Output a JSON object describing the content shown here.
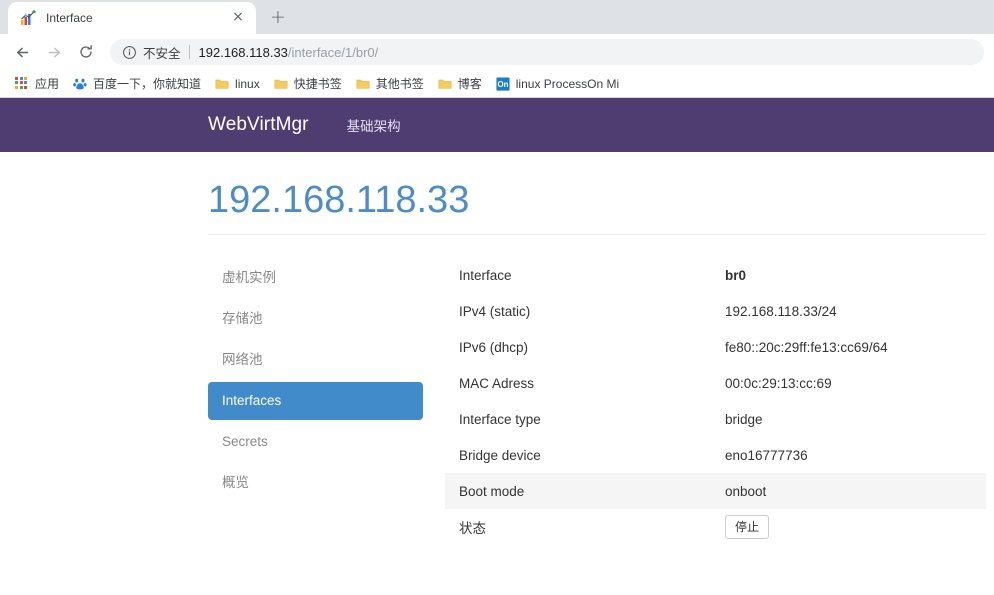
{
  "browser": {
    "tab": {
      "title": "Interface",
      "favicon_name": "chart-favicon",
      "close_label": "×"
    },
    "new_tab_label": "+",
    "nav": {
      "back_label": "back-arrow-icon",
      "forward_label": "forward-arrow-icon",
      "reload_label": "reload-icon"
    },
    "omnibox": {
      "security_label": "不安全",
      "url_host": "192.168.118.33",
      "url_path": "/interface/1/br0/",
      "full_url": "192.168.118.33/interface/1/br0/"
    },
    "bookmarks": [
      {
        "label": "应用",
        "icon": "apps-grid-icon"
      },
      {
        "label": "百度一下，你就知道",
        "icon": "baidu-icon"
      },
      {
        "label": "linux",
        "icon": "folder-icon"
      },
      {
        "label": "快捷书签",
        "icon": "folder-icon"
      },
      {
        "label": "其他书签",
        "icon": "folder-icon"
      },
      {
        "label": "博客",
        "icon": "folder-icon"
      },
      {
        "label": "linux  ProcessOn Mi",
        "icon": "processon-icon"
      }
    ]
  },
  "navbar": {
    "brand": "WebVirtMgr",
    "links": [
      {
        "label": "基础架构"
      }
    ]
  },
  "header": {
    "title": "192.168.118.33"
  },
  "sidebar": {
    "items": [
      {
        "label": "虚机实例",
        "active": false
      },
      {
        "label": "存储池",
        "active": false
      },
      {
        "label": "网络池",
        "active": false
      },
      {
        "label": "Interfaces",
        "active": true
      },
      {
        "label": "Secrets",
        "active": false
      },
      {
        "label": "概览",
        "active": false
      }
    ]
  },
  "detail": {
    "rows": [
      {
        "label": "Interface",
        "value": "br0",
        "bold": true,
        "striped": false,
        "is_button": false
      },
      {
        "label": "IPv4 (static)",
        "value": "192.168.118.33/24",
        "bold": false,
        "striped": false,
        "is_button": false
      },
      {
        "label": "IPv6 (dhcp)",
        "value": "fe80::20c:29ff:fe13:cc69/64",
        "bold": false,
        "striped": false,
        "is_button": false
      },
      {
        "label": "MAC Adress",
        "value": "00:0c:29:13:cc:69",
        "bold": false,
        "striped": false,
        "is_button": false
      },
      {
        "label": "Interface type",
        "value": "bridge",
        "bold": false,
        "striped": false,
        "is_button": false
      },
      {
        "label": "Bridge device",
        "value": "eno16777736",
        "bold": false,
        "striped": false,
        "is_button": false
      },
      {
        "label": "Boot mode",
        "value": "onboot",
        "bold": false,
        "striped": true,
        "is_button": false
      },
      {
        "label": "状态",
        "value": "停止",
        "bold": false,
        "striped": false,
        "is_button": true
      }
    ]
  },
  "colors": {
    "navbar_purple": "#4f3d72",
    "title_blue": "#4c8ccc",
    "active_blue": "#428bca",
    "striped_row": "#f5f5f5"
  }
}
